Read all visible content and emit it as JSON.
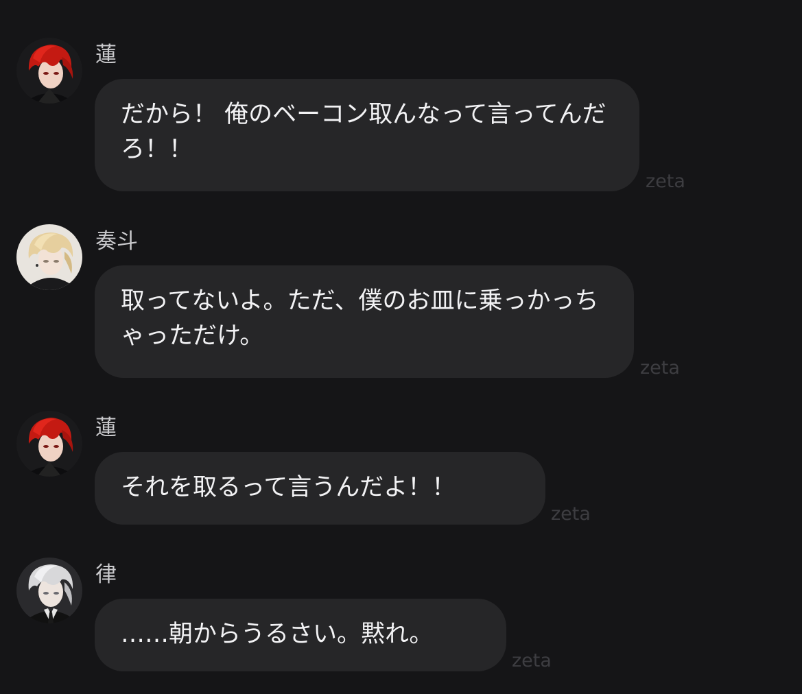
{
  "messages": [
    {
      "sender": "蓮",
      "avatar_icon": "red-hair-avatar-icon",
      "text": "だから！ 俺のベーコン取んなって言ってんだろ！！",
      "watermark": "zeta"
    },
    {
      "sender": "奏斗",
      "avatar_icon": "blonde-hair-avatar-icon",
      "text": "取ってないよ。ただ、僕のお皿に乗っかっちゃっただけ。",
      "watermark": "zeta"
    },
    {
      "sender": "蓮",
      "avatar_icon": "red-hair-avatar-icon",
      "text": "それを取るって言うんだよ！！",
      "watermark": "zeta"
    },
    {
      "sender": "律",
      "avatar_icon": "white-hair-avatar-icon",
      "text": "……朝からうるさい。黙れ。",
      "watermark": "zeta"
    }
  ],
  "colors": {
    "background": "#151517",
    "bubble": "#262628",
    "text": "#f2f2f4",
    "name": "#c9c9cc",
    "watermark": "#3d3d41"
  }
}
